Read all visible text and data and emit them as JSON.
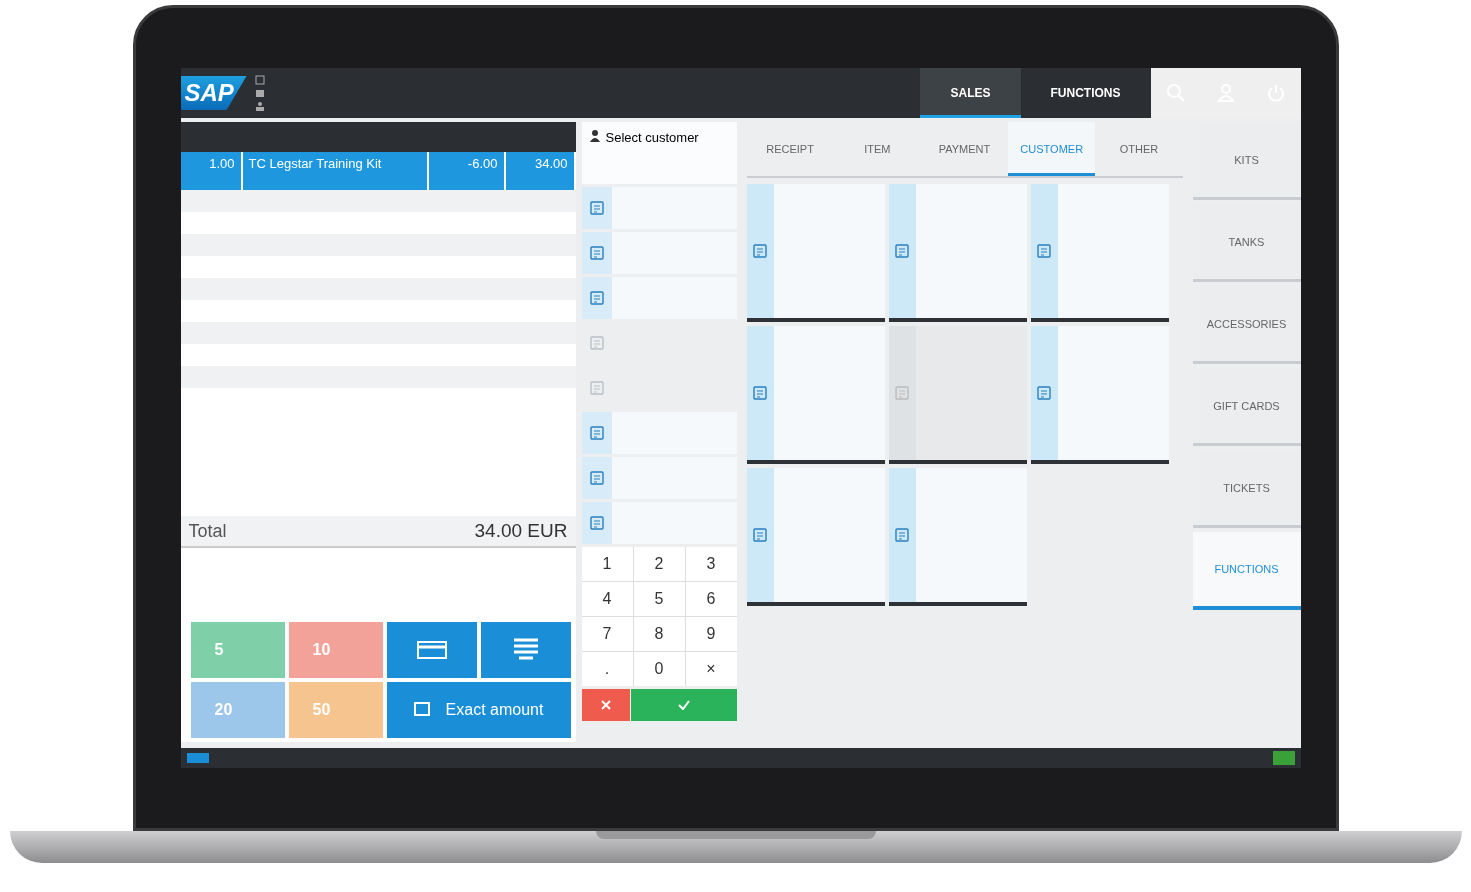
{
  "header": {
    "logo": "SAP",
    "nav": [
      {
        "label": "SALES",
        "selected": true
      },
      {
        "label": "FUNCTIONS",
        "selected": false
      }
    ]
  },
  "receipt": {
    "rows": [
      {
        "quantity": "1.00",
        "item": "TC Legstar Training Kit",
        "discount": "-6.00",
        "total": "34.00",
        "selected": true
      }
    ],
    "total_label": "Total",
    "total_value": "34.00 EUR"
  },
  "payment": {
    "banknotes": [
      {
        "value": "5",
        "color": "#7fcfa8"
      },
      {
        "value": "10",
        "color": "#f3a29a"
      },
      {
        "value": "20",
        "color": "#9cc6ea"
      },
      {
        "value": "50",
        "color": "#f6c48f"
      }
    ],
    "exact_amount": "Exact amount"
  },
  "customer": {
    "label": "Select customer"
  },
  "function_buttons": [
    {
      "disabled": false
    },
    {
      "disabled": false
    },
    {
      "disabled": false
    },
    {
      "disabled": true
    },
    {
      "disabled": true
    },
    {
      "disabled": false
    },
    {
      "disabled": false
    },
    {
      "disabled": false
    }
  ],
  "keypad": [
    "1",
    "2",
    "3",
    "4",
    "5",
    "6",
    "7",
    "8",
    "9",
    ".",
    "0",
    "×"
  ],
  "tabs": [
    {
      "label": "RECEIPT",
      "selected": false
    },
    {
      "label": "ITEM",
      "selected": false
    },
    {
      "label": "PAYMENT",
      "selected": false
    },
    {
      "label": "CUSTOMER",
      "selected": true
    },
    {
      "label": "OTHER",
      "selected": false
    }
  ],
  "tiles": [
    {
      "disabled": false
    },
    {
      "disabled": false
    },
    {
      "disabled": false
    },
    {
      "disabled": false
    },
    {
      "disabled": true
    },
    {
      "disabled": false
    },
    {
      "disabled": false
    },
    {
      "disabled": false
    }
  ],
  "categories": [
    {
      "label": "KITS",
      "selected": false
    },
    {
      "label": "TANKS",
      "selected": false
    },
    {
      "label": "ACCESSORIES",
      "selected": false
    },
    {
      "label": "GIFT CARDS",
      "selected": false
    },
    {
      "label": "TICKETS",
      "selected": false
    },
    {
      "label": "FUNCTIONS",
      "selected": true
    }
  ]
}
